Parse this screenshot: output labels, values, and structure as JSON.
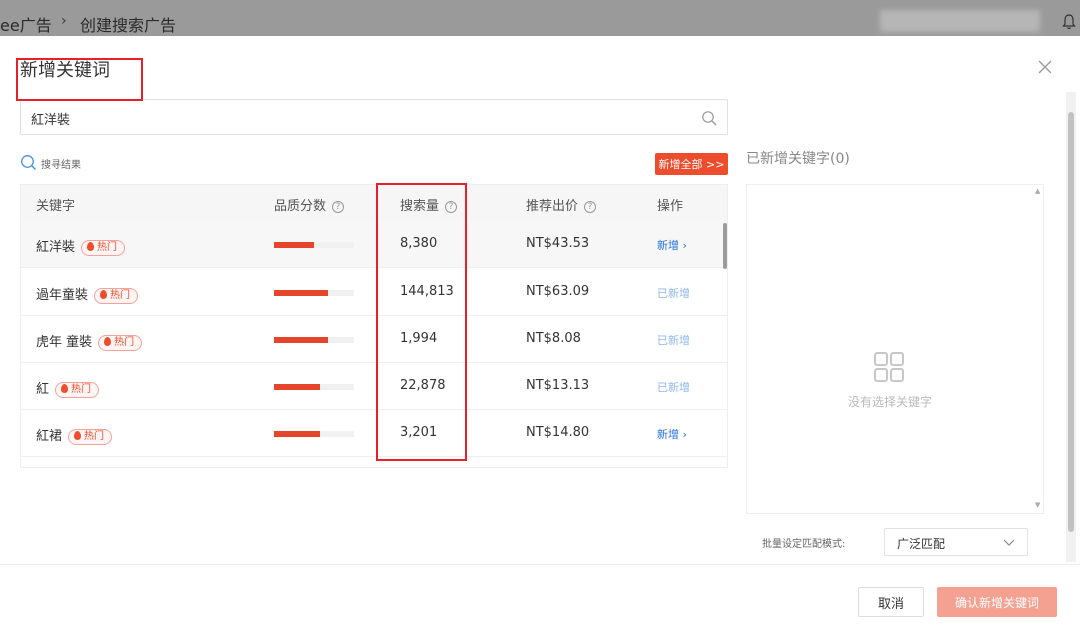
{
  "app": {
    "breadcrumb_root": "ee广告",
    "breadcrumb_sep": "›",
    "breadcrumb_current": "创建搜索广告"
  },
  "modal": {
    "title": "新增关键词",
    "search_value": "紅洋裝",
    "result_label": "搜寻结果",
    "add_all_label": "新增全部 >>",
    "table": {
      "headers": [
        "关键字",
        "品质分数",
        "搜索量",
        "推荐出价",
        "操作"
      ],
      "rows": [
        {
          "keyword": "紅洋裝",
          "tag": "热门",
          "quality": 0.5,
          "volume": "8,380",
          "bid": "NT$43.53",
          "action": "新增 ›",
          "action_state": "add"
        },
        {
          "keyword": "過年童裝",
          "tag": "热门",
          "quality": 0.68,
          "volume": "144,813",
          "bid": "NT$63.09",
          "action": "已新增",
          "action_state": "done"
        },
        {
          "keyword": "虎年 童裝",
          "tag": "热门",
          "quality": 0.68,
          "volume": "1,994",
          "bid": "NT$8.08",
          "action": "已新增",
          "action_state": "done"
        },
        {
          "keyword": "紅",
          "tag": "热门",
          "quality": 0.58,
          "volume": "22,878",
          "bid": "NT$13.13",
          "action": "已新增",
          "action_state": "done"
        },
        {
          "keyword": "紅裙",
          "tag": "热门",
          "quality": 0.58,
          "volume": "3,201",
          "bid": "NT$14.80",
          "action": "新增 ›",
          "action_state": "add"
        }
      ]
    },
    "added_title": "已新增关键字(0)",
    "empty_text": "没有选择关键字",
    "match_label": "批量设定匹配模式:",
    "match_value": "广泛匹配",
    "cancel_label": "取消",
    "confirm_label": "确认新增关键词"
  },
  "colors": {
    "accent": "#ee4d2d",
    "link": "#2673dd",
    "highlight": "#e8202a"
  }
}
